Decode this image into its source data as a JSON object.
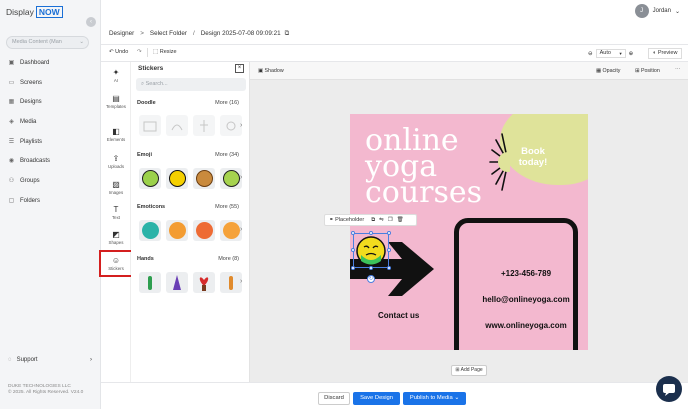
{
  "brand": {
    "display": "Display",
    "now": "NOW"
  },
  "sidebar": {
    "media_select": "Media Content (Man",
    "items": [
      {
        "label": "Dashboard",
        "icon": "dashboard-icon",
        "glyph": "▣"
      },
      {
        "label": "Screens",
        "icon": "screen-icon",
        "glyph": "▭"
      },
      {
        "label": "Designs",
        "icon": "designs-icon",
        "glyph": "▦"
      },
      {
        "label": "Media",
        "icon": "media-icon",
        "glyph": "◈"
      },
      {
        "label": "Playlists",
        "icon": "playlists-icon",
        "glyph": "☰"
      },
      {
        "label": "Broadcasts",
        "icon": "broadcast-icon",
        "glyph": "◉"
      },
      {
        "label": "Groups",
        "icon": "groups-icon",
        "glyph": "⚇"
      },
      {
        "label": "Folders",
        "icon": "folder-icon",
        "glyph": "▢"
      }
    ],
    "support": "Support",
    "footer_line1": "DUKE TECHNOLOGIES LLC",
    "footer_line2": "© 2025. All Rights Reserved. V24.0"
  },
  "user": {
    "initial": "J",
    "name": "Jordan"
  },
  "breadcrumb": {
    "root": "Designer",
    "folder": "Select Folder",
    "current": "Design 2025-07-08 09:09:21"
  },
  "toolbar": {
    "undo": "Undo",
    "resize": "Resize",
    "zoom_value": "Auto",
    "preview": "Preview"
  },
  "rail": [
    {
      "label": "AI",
      "icon": "ai-sparkle-icon",
      "glyph": "✦"
    },
    {
      "label": "Templates",
      "icon": "templates-icon",
      "glyph": "▤"
    },
    {
      "label": "Elements",
      "icon": "elements-icon",
      "glyph": "◧"
    },
    {
      "label": "Uploads",
      "icon": "upload-icon",
      "glyph": "⇪"
    },
    {
      "label": "Images",
      "icon": "image-icon",
      "glyph": "▨"
    },
    {
      "label": "Text",
      "icon": "text-icon",
      "glyph": "T"
    },
    {
      "label": "Shapes",
      "icon": "shapes-icon",
      "glyph": "◩"
    },
    {
      "label": "Stickers",
      "icon": "sticker-icon",
      "glyph": "☺"
    }
  ],
  "stickers": {
    "title": "Stickers",
    "search_placeholder": "Search...",
    "sections": [
      {
        "title": "Doodle",
        "more": "More (16)"
      },
      {
        "title": "Emoji",
        "more": "More (34)"
      },
      {
        "title": "Emoticons",
        "more": "More (55)"
      },
      {
        "title": "Hands",
        "more": "More (8)"
      }
    ]
  },
  "context": {
    "shadow": "Shadow",
    "opacity": "Opacity",
    "position": "Position"
  },
  "design": {
    "line1": "online",
    "line2": "yoga",
    "line3": "courses",
    "book": "Book today!",
    "phone": "+123-456-789",
    "email": "hello@onlineyoga.com",
    "web": "www.onlineyoga.com",
    "contact": "Contact us"
  },
  "floatbar": {
    "placeholder": "Placeholder"
  },
  "add_page": "Add Page",
  "actions": {
    "discard": "Discard",
    "save": "Save Design",
    "publish": "Publish to Media"
  }
}
